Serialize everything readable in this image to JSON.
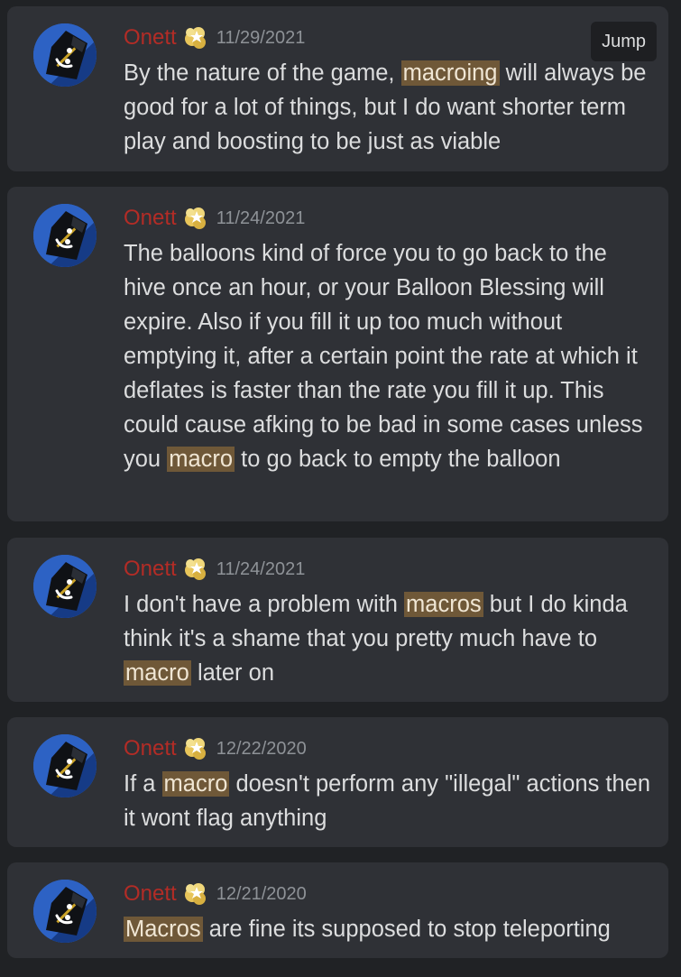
{
  "results": [
    {
      "username": "Onett",
      "badge_icon": "star-burst-icon",
      "timestamp": "11/29/2021",
      "segments": [
        {
          "text": "By the nature of the game, ",
          "highlight": false
        },
        {
          "text": "macroing",
          "highlight": true
        },
        {
          "text": " will always be good for a lot of things, but I do want shorter term play and boosting to be just as viable",
          "highlight": false
        }
      ],
      "jump_label": "Jump"
    },
    {
      "username": "Onett",
      "badge_icon": "star-burst-icon",
      "timestamp": "11/24/2021",
      "segments": [
        {
          "text": "The balloons kind of force you to go back to the hive once an hour, or your Balloon Blessing will expire. Also if you fill it up too much without emptying it, after a certain point the rate at which it deflates is faster than the rate you fill it up. This could cause afking to be bad in some cases unless you ",
          "highlight": false
        },
        {
          "text": "macro",
          "highlight": true
        },
        {
          "text": " to go back to empty the balloon",
          "highlight": false
        }
      ]
    },
    {
      "username": "Onett",
      "badge_icon": "star-burst-icon",
      "timestamp": "11/24/2021",
      "segments": [
        {
          "text": "I don't have a problem with ",
          "highlight": false
        },
        {
          "text": "macros",
          "highlight": true
        },
        {
          "text": " but I do kinda think it's a shame that you pretty much have to ",
          "highlight": false
        },
        {
          "text": "macro",
          "highlight": true
        },
        {
          "text": " later on",
          "highlight": false
        }
      ]
    },
    {
      "username": "Onett",
      "badge_icon": "star-burst-icon",
      "timestamp": "12/22/2020",
      "segments": [
        {
          "text": "If a ",
          "highlight": false
        },
        {
          "text": "macro",
          "highlight": true
        },
        {
          "text": " doesn't perform any \"illegal\" actions then it wont flag anything",
          "highlight": false
        }
      ]
    },
    {
      "username": "Onett",
      "badge_icon": "star-burst-icon",
      "timestamp": "12/21/2020",
      "segments": [
        {
          "text": "Macros",
          "highlight": true
        },
        {
          "text": " are fine its supposed to stop teleporting",
          "highlight": false
        }
      ]
    }
  ],
  "colors": {
    "background": "#202225",
    "card": "#2f3136",
    "username": "#b32c26",
    "timestamp": "#8e9297",
    "text": "#dcddde",
    "highlight": "#6f5838",
    "avatar": "#2d62c4"
  }
}
